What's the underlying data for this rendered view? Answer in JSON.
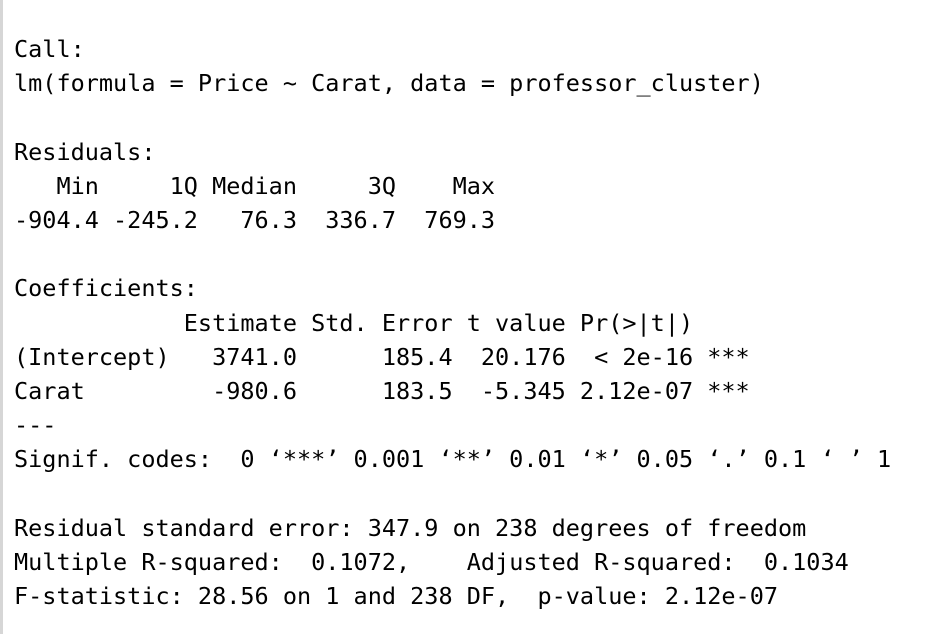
{
  "output_lines": [
    "Call:",
    "lm(formula = Price ~ Carat, data = professor_cluster)",
    "",
    "Residuals:",
    "   Min     1Q Median     3Q    Max ",
    "-904.4 -245.2   76.3  336.7  769.3 ",
    "",
    "Coefficients:",
    "            Estimate Std. Error t value Pr(>|t|)    ",
    "(Intercept)   3741.0      185.4  20.176  < 2e-16 ***",
    "Carat         -980.6      183.5  -5.345 2.12e-07 ***",
    "---",
    "Signif. codes:  0 ‘***’ 0.001 ‘**’ 0.01 ‘*’ 0.05 ‘.’ 0.1 ‘ ’ 1",
    "",
    "Residual standard error: 347.9 on 238 degrees of freedom",
    "Multiple R-squared:  0.1072,\tAdjusted R-squared:  0.1034 ",
    "F-statistic: 28.56 on 1 and 238 DF,  p-value: 2.12e-07"
  ]
}
